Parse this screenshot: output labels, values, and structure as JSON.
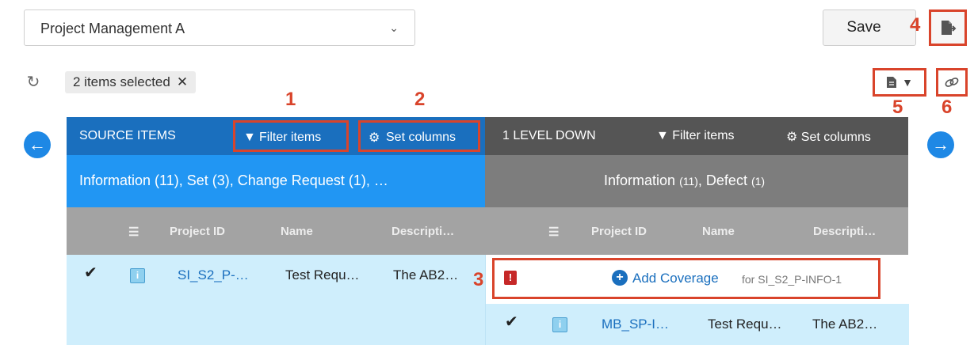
{
  "project_select": {
    "value": "Project Management A"
  },
  "toolbar": {
    "save_label": "Save",
    "selection_label": "2 items selected"
  },
  "callouts": [
    "1",
    "2",
    "3",
    "4",
    "5",
    "6"
  ],
  "source": {
    "title": "SOURCE ITEMS",
    "filter_label": "Filter items",
    "columns_label": "Set columns",
    "summary": "Information (11), Set (3), Change Request (1), …",
    "columns": [
      "Project ID",
      "Name",
      "Descripti…"
    ],
    "rows": [
      {
        "project_id": "SI_S2_P-…",
        "name": "Test Requ…",
        "description": "The AB2…"
      }
    ]
  },
  "target": {
    "title": "1 LEVEL DOWN",
    "filter_label": "Filter items",
    "columns_label": "Set columns",
    "summary_main": "Information",
    "summary_count1": "(11)",
    "summary_sep": ", Defect",
    "summary_count2": "(1)",
    "columns": [
      "Project ID",
      "Name",
      "Descripti…"
    ],
    "add_coverage_label": "Add Coverage",
    "add_coverage_for": "for SI_S2_P-INFO-1",
    "rows": [
      {
        "project_id": "MB_SP-I…",
        "name": "Test Requ…",
        "description": "The AB2…"
      }
    ]
  },
  "colors": {
    "accent_blue": "#2196f3",
    "header_blue": "#1a6fbe",
    "callout_red": "#d9442b",
    "selected_row": "#cfeefc"
  }
}
